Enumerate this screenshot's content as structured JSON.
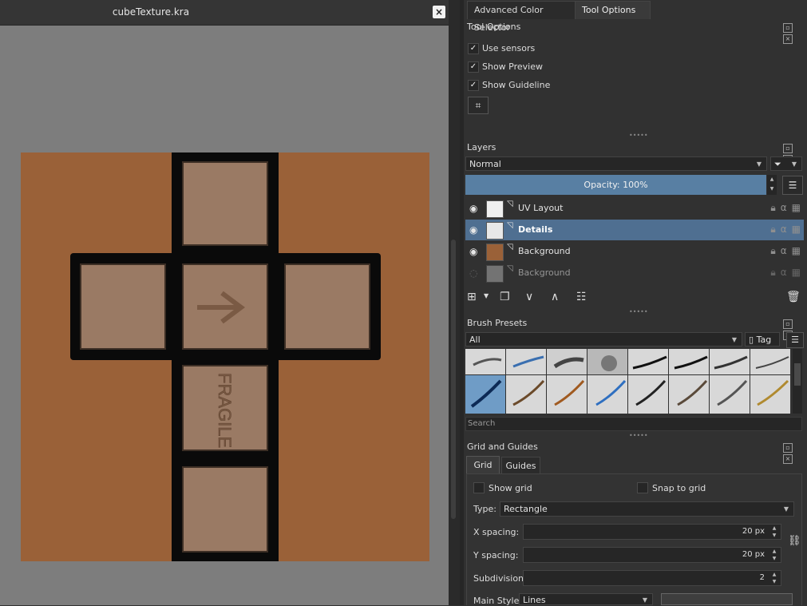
{
  "canvas": {
    "title": "cubeTexture.kra",
    "close_glyph": "×",
    "artwork_text": "FRAGILE",
    "colors": {
      "background": "#9a6138",
      "face": "#9a7a64",
      "border": "#0a0a0a"
    }
  },
  "tabs": [
    {
      "label": "Advanced Color Selector",
      "active": false
    },
    {
      "label": "Tool Options",
      "active": true
    }
  ],
  "tool_options": {
    "title": "Tool Options",
    "checkboxes": [
      {
        "label": "Use sensors",
        "checked": true
      },
      {
        "label": "Show Preview",
        "checked": true
      },
      {
        "label": "Show Guideline",
        "checked": true
      }
    ],
    "button_icon": "transform-icon"
  },
  "layers": {
    "title": "Layers",
    "blend_mode": "Normal",
    "opacity_label": "Opacity:  100%",
    "items": [
      {
        "name": "UV Layout",
        "visible": true,
        "selected": false,
        "thumb": "uv"
      },
      {
        "name": "Details",
        "visible": true,
        "selected": true,
        "thumb": "details"
      },
      {
        "name": "Background",
        "visible": true,
        "selected": false,
        "thumb": "bg"
      },
      {
        "name": "Background",
        "visible": false,
        "selected": false,
        "thumb": "bg2"
      }
    ]
  },
  "brush_presets": {
    "title": "Brush Presets",
    "filter": "All",
    "tag_label": "Tag",
    "search_placeholder": "Search"
  },
  "grid_guides": {
    "title": "Grid and Guides",
    "tabs": [
      "Grid",
      "Guides"
    ],
    "show_grid_label": "Show grid",
    "snap_label": "Snap to grid",
    "type_label": "Type:",
    "type_value": "Rectangle",
    "x_spacing_label": "X spacing:",
    "x_spacing_value": "20 px",
    "y_spacing_label": "Y spacing:",
    "y_spacing_value": "20 px",
    "subdivision_label": "Subdivision:",
    "subdivision_value": "2",
    "main_style_label": "Main Style:",
    "main_style_value": "Lines"
  },
  "colors": {
    "selection": "#4f6f91",
    "accent": "#587fa3"
  }
}
